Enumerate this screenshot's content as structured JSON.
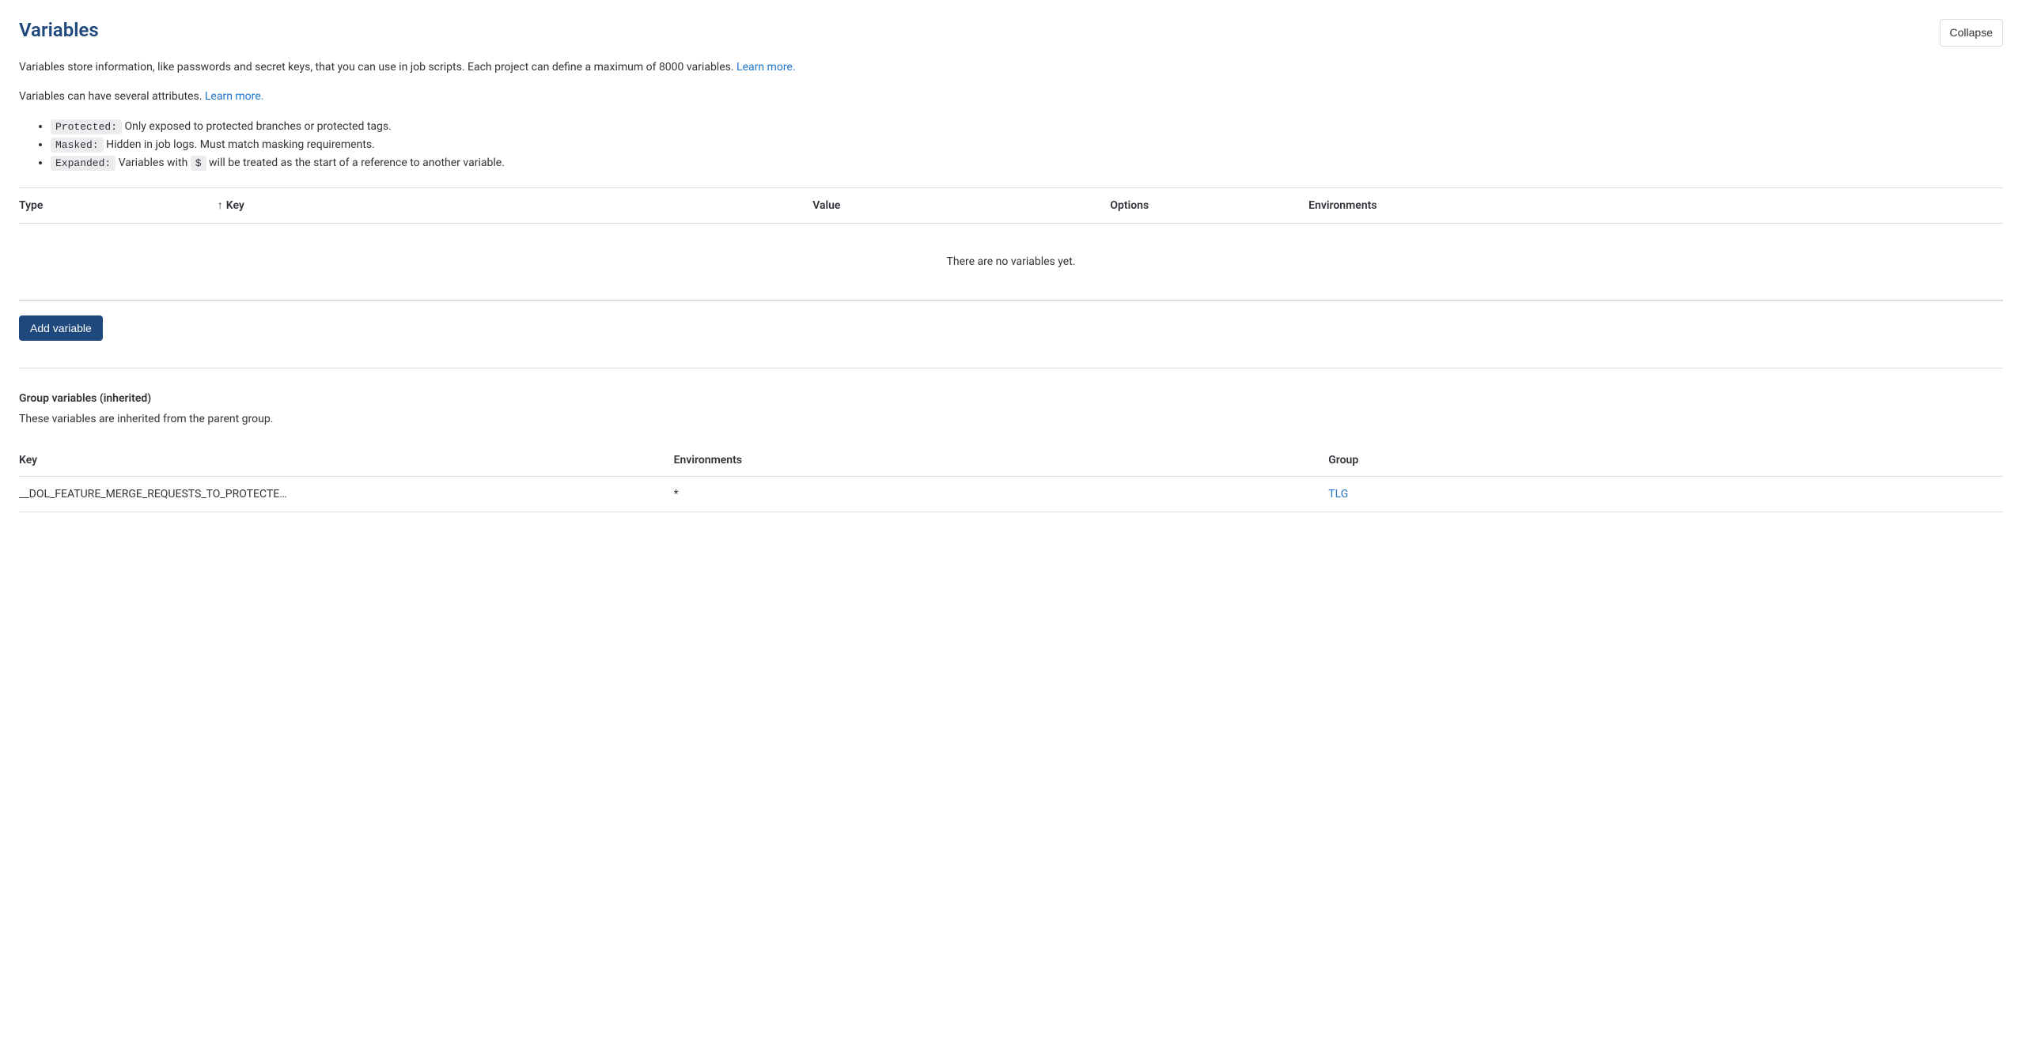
{
  "header": {
    "title": "Variables",
    "collapse_label": "Collapse"
  },
  "description": {
    "main_text": "Variables store information, like passwords and secret keys, that you can use in job scripts. Each project can define a maximum of 8000 variables. ",
    "learn_more": "Learn more.",
    "attributes_intro": "Variables can have several attributes. ",
    "attributes_learn_more": "Learn more."
  },
  "attributes": {
    "protected_label": "Protected:",
    "protected_desc": " Only exposed to protected branches or protected tags.",
    "masked_label": "Masked:",
    "masked_desc": " Hidden in job logs. Must match masking requirements.",
    "expanded_label": "Expanded:",
    "expanded_desc_before": " Variables with ",
    "expanded_symbol": "$",
    "expanded_desc_after": " will be treated as the start of a reference to another variable."
  },
  "variables_table": {
    "headers": {
      "type": "Type",
      "key": "Key",
      "value": "Value",
      "options": "Options",
      "environments": "Environments"
    },
    "empty_message": "There are no variables yet.",
    "add_button_label": "Add variable"
  },
  "group_variables": {
    "title": "Group variables (inherited)",
    "description": "These variables are inherited from the parent group.",
    "headers": {
      "key": "Key",
      "environments": "Environments",
      "group": "Group"
    },
    "rows": [
      {
        "key": "__DOL_FEATURE_MERGE_REQUESTS_TO_PROTECTE…",
        "environments": "*",
        "group": "TLG"
      }
    ]
  }
}
